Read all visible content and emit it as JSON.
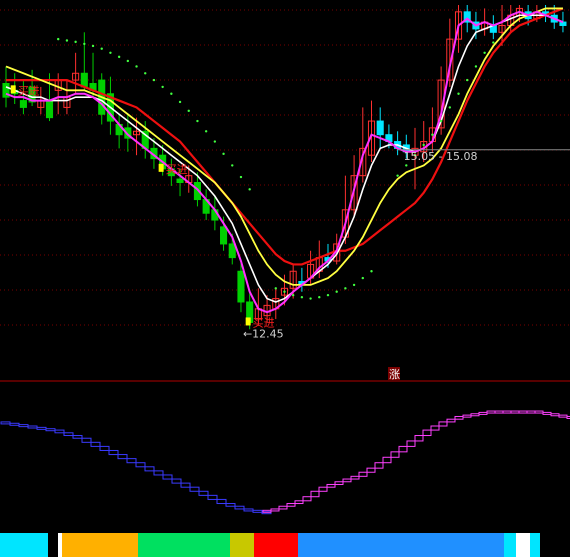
{
  "chart_data": {
    "type": "candlestick",
    "main_panel": {
      "price_range": [
        12.0,
        17.2
      ],
      "candles": [
        {
          "o": 16.05,
          "c": 15.85,
          "h": 16.3,
          "l": 15.7,
          "up": false
        },
        {
          "o": 15.95,
          "c": 15.9,
          "h": 16.2,
          "l": 15.75,
          "up": false
        },
        {
          "o": 15.8,
          "c": 15.7,
          "h": 16.1,
          "l": 15.6,
          "up": false
        },
        {
          "o": 16.0,
          "c": 15.78,
          "h": 16.25,
          "l": 15.72,
          "up": false
        },
        {
          "o": 15.7,
          "c": 15.8,
          "h": 16.0,
          "l": 15.6,
          "up": true
        },
        {
          "o": 15.8,
          "c": 15.55,
          "h": 16.2,
          "l": 15.5,
          "up": false
        },
        {
          "o": 15.95,
          "c": 16.1,
          "h": 16.2,
          "l": 15.6,
          "up": true
        },
        {
          "o": 15.7,
          "c": 15.85,
          "h": 16.1,
          "l": 15.6,
          "up": true
        },
        {
          "o": 16.1,
          "c": 16.2,
          "h": 16.5,
          "l": 15.9,
          "up": true
        },
        {
          "o": 16.2,
          "c": 16.0,
          "h": 16.8,
          "l": 15.95,
          "up": false
        },
        {
          "o": 16.05,
          "c": 15.95,
          "h": 16.5,
          "l": 15.85,
          "up": false
        },
        {
          "o": 16.1,
          "c": 15.6,
          "h": 16.2,
          "l": 15.45,
          "up": false
        },
        {
          "o": 15.9,
          "c": 15.5,
          "h": 16.15,
          "l": 15.3,
          "up": false
        },
        {
          "o": 15.45,
          "c": 15.3,
          "h": 15.6,
          "l": 15.1,
          "up": false
        },
        {
          "o": 15.4,
          "c": 15.25,
          "h": 15.6,
          "l": 15.05,
          "up": false
        },
        {
          "o": 15.3,
          "c": 15.35,
          "h": 15.55,
          "l": 15.0,
          "up": true
        },
        {
          "o": 15.35,
          "c": 15.1,
          "h": 15.5,
          "l": 14.95,
          "up": false
        },
        {
          "o": 15.1,
          "c": 14.95,
          "h": 15.25,
          "l": 14.8,
          "up": false
        },
        {
          "o": 15.0,
          "c": 14.8,
          "h": 15.15,
          "l": 14.7,
          "up": false
        },
        {
          "o": 14.8,
          "c": 14.7,
          "h": 14.95,
          "l": 14.55,
          "up": false
        },
        {
          "o": 14.65,
          "c": 14.6,
          "h": 14.8,
          "l": 14.4,
          "up": false
        },
        {
          "o": 14.6,
          "c": 14.7,
          "h": 14.85,
          "l": 14.45,
          "up": true
        },
        {
          "o": 14.6,
          "c": 14.35,
          "h": 14.75,
          "l": 14.25,
          "up": false
        },
        {
          "o": 14.35,
          "c": 14.15,
          "h": 14.5,
          "l": 14.05,
          "up": false
        },
        {
          "o": 14.2,
          "c": 14.05,
          "h": 14.4,
          "l": 13.9,
          "up": false
        },
        {
          "o": 13.95,
          "c": 13.7,
          "h": 14.1,
          "l": 13.6,
          "up": false
        },
        {
          "o": 13.7,
          "c": 13.5,
          "h": 13.85,
          "l": 13.4,
          "up": false
        },
        {
          "o": 13.3,
          "c": 12.85,
          "h": 13.45,
          "l": 12.7,
          "up": false
        },
        {
          "o": 12.85,
          "c": 12.55,
          "h": 13.0,
          "l": 12.45,
          "up": false
        },
        {
          "o": 12.6,
          "c": 12.75,
          "h": 13.05,
          "l": 12.5,
          "up": true
        },
        {
          "o": 12.65,
          "c": 12.8,
          "h": 12.95,
          "l": 12.55,
          "up": true
        },
        {
          "o": 12.75,
          "c": 12.9,
          "h": 13.05,
          "l": 12.6,
          "up": true
        },
        {
          "o": 12.95,
          "c": 13.05,
          "h": 13.25,
          "l": 12.8,
          "up": true
        },
        {
          "o": 13.05,
          "c": 13.3,
          "h": 13.4,
          "l": 12.9,
          "up": true
        },
        {
          "o": 13.1,
          "c": 13.15,
          "h": 13.35,
          "l": 13.0,
          "up": false
        },
        {
          "o": 13.2,
          "c": 13.4,
          "h": 13.6,
          "l": 13.1,
          "up": true
        },
        {
          "o": 13.3,
          "c": 13.5,
          "h": 13.75,
          "l": 13.2,
          "up": true
        },
        {
          "o": 13.5,
          "c": 13.45,
          "h": 13.7,
          "l": 13.35,
          "up": false
        },
        {
          "o": 13.45,
          "c": 13.7,
          "h": 13.85,
          "l": 13.4,
          "up": true
        },
        {
          "o": 13.8,
          "c": 14.2,
          "h": 14.7,
          "l": 13.7,
          "up": true
        },
        {
          "o": 14.2,
          "c": 14.7,
          "h": 15.0,
          "l": 14.1,
          "up": true
        },
        {
          "o": 14.7,
          "c": 15.1,
          "h": 15.7,
          "l": 14.6,
          "up": true
        },
        {
          "o": 15.0,
          "c": 15.5,
          "h": 15.8,
          "l": 14.9,
          "up": true
        },
        {
          "o": 15.5,
          "c": 15.3,
          "h": 15.7,
          "l": 15.1,
          "up": false
        },
        {
          "o": 15.3,
          "c": 15.2,
          "h": 15.45,
          "l": 15.1,
          "up": false
        },
        {
          "o": 15.2,
          "c": 15.1,
          "h": 15.35,
          "l": 15.0,
          "up": false
        },
        {
          "o": 15.15,
          "c": 15.05,
          "h": 15.3,
          "l": 14.95,
          "up": false
        },
        {
          "o": 15.0,
          "c": 15.1,
          "h": 15.4,
          "l": 14.5,
          "up": true
        },
        {
          "o": 15.05,
          "c": 15.2,
          "h": 15.5,
          "l": 14.9,
          "up": true
        },
        {
          "o": 15.2,
          "c": 15.4,
          "h": 15.7,
          "l": 15.05,
          "up": true
        },
        {
          "o": 15.4,
          "c": 16.1,
          "h": 16.3,
          "l": 15.3,
          "up": true
        },
        {
          "o": 16.1,
          "c": 16.7,
          "h": 17.0,
          "l": 16.0,
          "up": true
        },
        {
          "o": 16.7,
          "c": 17.1,
          "h": 17.2,
          "l": 16.5,
          "up": true
        },
        {
          "o": 17.1,
          "c": 16.95,
          "h": 17.2,
          "l": 16.8,
          "up": false
        },
        {
          "o": 16.95,
          "c": 16.85,
          "h": 17.1,
          "l": 16.7,
          "up": false
        },
        {
          "o": 16.85,
          "c": 16.95,
          "h": 17.15,
          "l": 16.75,
          "up": true
        },
        {
          "o": 16.9,
          "c": 16.8,
          "h": 17.05,
          "l": 16.7,
          "up": false
        },
        {
          "o": 16.8,
          "c": 16.9,
          "h": 17.2,
          "l": 16.6,
          "up": true
        },
        {
          "o": 16.9,
          "c": 17.05,
          "h": 17.2,
          "l": 16.8,
          "up": true
        },
        {
          "o": 17.05,
          "c": 17.15,
          "h": 17.2,
          "l": 16.95,
          "up": true
        },
        {
          "o": 17.1,
          "c": 17.0,
          "h": 17.2,
          "l": 16.9,
          "up": false
        },
        {
          "o": 17.0,
          "c": 17.1,
          "h": 17.2,
          "l": 16.95,
          "up": true
        },
        {
          "o": 17.1,
          "c": 17.05,
          "h": 17.2,
          "l": 16.95,
          "up": false
        },
        {
          "o": 17.05,
          "c": 16.95,
          "h": 17.2,
          "l": 16.85,
          "up": false
        },
        {
          "o": 16.95,
          "c": 16.9,
          "h": 17.1,
          "l": 16.8,
          "up": false
        }
      ],
      "ma_white": [
        16.0,
        15.95,
        15.9,
        15.85,
        15.85,
        15.8,
        15.8,
        15.8,
        15.85,
        15.85,
        15.85,
        15.8,
        15.7,
        15.6,
        15.5,
        15.4,
        15.3,
        15.2,
        15.1,
        15.0,
        14.9,
        14.8,
        14.7,
        14.55,
        14.4,
        14.2,
        14.0,
        13.7,
        13.4,
        13.1,
        12.9,
        12.85,
        12.9,
        13.0,
        13.1,
        13.2,
        13.3,
        13.4,
        13.55,
        13.8,
        14.1,
        14.5,
        14.85,
        15.1,
        15.15,
        15.15,
        15.1,
        15.05,
        15.1,
        15.2,
        15.5,
        15.9,
        16.3,
        16.6,
        16.8,
        16.85,
        16.9,
        16.95,
        17.0,
        17.05,
        17.05,
        17.05,
        17.05,
        17.0,
        16.95
      ],
      "ma_yellow": [
        16.3,
        16.25,
        16.2,
        16.15,
        16.1,
        16.05,
        16.0,
        15.95,
        15.95,
        15.95,
        15.9,
        15.85,
        15.8,
        15.7,
        15.6,
        15.5,
        15.4,
        15.3,
        15.2,
        15.1,
        15.0,
        14.9,
        14.8,
        14.7,
        14.6,
        14.45,
        14.3,
        14.1,
        13.85,
        13.6,
        13.4,
        13.25,
        13.15,
        13.1,
        13.1,
        13.1,
        13.15,
        13.2,
        13.3,
        13.45,
        13.6,
        13.8,
        14.05,
        14.3,
        14.5,
        14.65,
        14.75,
        14.8,
        14.85,
        14.95,
        15.1,
        15.35,
        15.6,
        15.9,
        16.15,
        16.4,
        16.6,
        16.75,
        16.9,
        17.0,
        17.05,
        17.1,
        17.15,
        17.15,
        17.15
      ],
      "ma_magenta": [
        15.9,
        15.85,
        15.85,
        15.8,
        15.8,
        15.8,
        15.85,
        15.85,
        15.9,
        15.9,
        15.85,
        15.75,
        15.6,
        15.45,
        15.3,
        15.2,
        15.1,
        15.0,
        14.9,
        14.8,
        14.7,
        14.6,
        14.5,
        14.35,
        14.2,
        14.0,
        13.8,
        13.45,
        13.0,
        12.75,
        12.7,
        12.75,
        12.85,
        13.0,
        13.1,
        13.2,
        13.35,
        13.45,
        13.6,
        14.0,
        14.5,
        15.0,
        15.3,
        15.25,
        15.2,
        15.1,
        15.05,
        15.05,
        15.1,
        15.2,
        15.6,
        16.3,
        16.9,
        17.0,
        16.9,
        16.95,
        16.9,
        16.95,
        17.05,
        17.1,
        17.05,
        17.1,
        17.05,
        17.0,
        16.95
      ],
      "ma_red": [
        16.1,
        16.1,
        16.1,
        16.1,
        16.1,
        16.1,
        16.1,
        16.1,
        16.05,
        16.0,
        15.95,
        15.9,
        15.85,
        15.8,
        15.75,
        15.7,
        15.6,
        15.5,
        15.4,
        15.3,
        15.2,
        15.05,
        14.9,
        14.75,
        14.6,
        14.45,
        14.3,
        14.15,
        14.0,
        13.85,
        13.7,
        13.55,
        13.45,
        13.4,
        13.4,
        13.45,
        13.5,
        13.55,
        13.6,
        13.6,
        13.65,
        13.7,
        13.8,
        13.9,
        14.0,
        14.1,
        14.2,
        14.3,
        14.45,
        14.65,
        14.9,
        15.2,
        15.5,
        15.8,
        16.05,
        16.3,
        16.5,
        16.65,
        16.8,
        16.9,
        16.95,
        17.0,
        17.05,
        17.1,
        17.15
      ],
      "sar_dots": [
        {
          "i": 6,
          "v": 16.7
        },
        {
          "i": 7,
          "v": 16.68
        },
        {
          "i": 8,
          "v": 16.66
        },
        {
          "i": 9,
          "v": 16.63
        },
        {
          "i": 10,
          "v": 16.6
        },
        {
          "i": 11,
          "v": 16.56
        },
        {
          "i": 12,
          "v": 16.5
        },
        {
          "i": 13,
          "v": 16.44
        },
        {
          "i": 14,
          "v": 16.38
        },
        {
          "i": 15,
          "v": 16.3
        },
        {
          "i": 16,
          "v": 16.2
        },
        {
          "i": 17,
          "v": 16.1
        },
        {
          "i": 18,
          "v": 16.0
        },
        {
          "i": 19,
          "v": 15.9
        },
        {
          "i": 20,
          "v": 15.78
        },
        {
          "i": 21,
          "v": 15.65
        },
        {
          "i": 22,
          "v": 15.5
        },
        {
          "i": 23,
          "v": 15.35
        },
        {
          "i": 24,
          "v": 15.2
        },
        {
          "i": 25,
          "v": 15.02
        },
        {
          "i": 26,
          "v": 14.85
        },
        {
          "i": 27,
          "v": 14.68
        },
        {
          "i": 28,
          "v": 14.5
        },
        {
          "i": 31,
          "v": 13.05
        },
        {
          "i": 32,
          "v": 13.0
        },
        {
          "i": 33,
          "v": 12.95
        },
        {
          "i": 34,
          "v": 12.92
        },
        {
          "i": 35,
          "v": 12.9
        },
        {
          "i": 36,
          "v": 12.92
        },
        {
          "i": 37,
          "v": 12.95
        },
        {
          "i": 38,
          "v": 13.0
        },
        {
          "i": 39,
          "v": 13.05
        },
        {
          "i": 40,
          "v": 13.1
        },
        {
          "i": 41,
          "v": 13.2
        },
        {
          "i": 42,
          "v": 13.3
        },
        {
          "i": 45,
          "v": 14.7
        },
        {
          "i": 46,
          "v": 14.85
        },
        {
          "i": 47,
          "v": 15.0
        },
        {
          "i": 48,
          "v": 15.15
        },
        {
          "i": 49,
          "v": 15.3
        },
        {
          "i": 50,
          "v": 15.5
        },
        {
          "i": 51,
          "v": 15.7
        },
        {
          "i": 52,
          "v": 15.9
        },
        {
          "i": 53,
          "v": 16.1
        },
        {
          "i": 54,
          "v": 16.3
        },
        {
          "i": 55,
          "v": 16.5
        },
        {
          "i": 56,
          "v": 16.65
        }
      ],
      "signals": [
        {
          "i": 1,
          "text": "买进",
          "v": 15.95
        },
        {
          "i": 18,
          "text": "买进",
          "v": 14.8
        },
        {
          "i": 28,
          "text": "买进",
          "v": 12.55
        }
      ],
      "low_label": {
        "i": 27,
        "text": "12.45",
        "v": 12.45
      },
      "range_label": {
        "i": 45,
        "text": "15.05 - 15.08",
        "v": 15.05
      },
      "marker_text": "涨"
    },
    "sub_panel": {
      "range": [
        0,
        100
      ],
      "series": [
        {
          "color": "#3a3aff",
          "values": [
            78,
            77,
            76,
            75,
            74,
            73,
            72,
            70,
            68,
            66,
            63,
            60,
            57,
            54,
            51,
            48,
            45,
            42,
            39,
            36,
            33,
            30,
            27,
            24,
            21,
            18,
            16,
            14,
            13,
            12,
            12
          ]
        },
        {
          "color": "#ff40ff",
          "values": [
            12,
            13,
            14,
            16,
            18,
            20,
            23,
            27,
            30,
            32,
            34,
            36,
            38,
            41,
            44,
            48,
            52,
            56,
            60,
            64,
            68,
            72,
            75,
            78,
            80,
            82,
            83,
            84,
            85,
            86,
            86,
            86,
            86,
            86,
            86,
            85,
            84,
            83,
            82,
            81,
            80
          ]
        }
      ]
    },
    "bottom_bar": [
      {
        "color": "#00e5ff",
        "w": 48
      },
      {
        "color": "#000000",
        "w": 10
      },
      {
        "color": "#ffffff",
        "w": 4
      },
      {
        "color": "#ffb000",
        "w": 76
      },
      {
        "color": "#00e060",
        "w": 92
      },
      {
        "color": "#c8c800",
        "w": 24
      },
      {
        "color": "#ff0000",
        "w": 44
      },
      {
        "color": "#2090ff",
        "w": 206
      },
      {
        "color": "#00e5ff",
        "w": 12
      },
      {
        "color": "#ffffff",
        "w": 14
      },
      {
        "color": "#00e5ff",
        "w": 10
      },
      {
        "color": "#000000",
        "w": 30
      }
    ]
  }
}
